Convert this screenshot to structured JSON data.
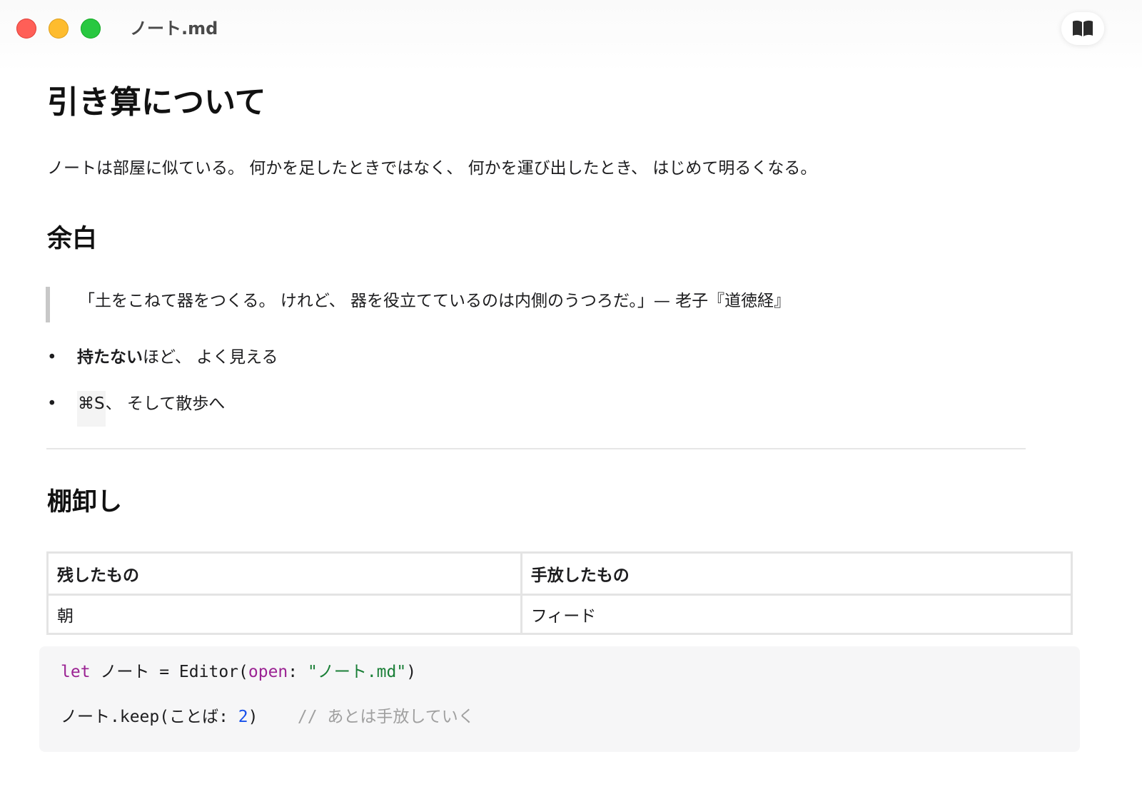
{
  "window": {
    "title": "ノート.md",
    "reader_icon": "book-open-icon"
  },
  "document": {
    "title": "引き算について",
    "intro": "ノートは部屋に似ている。 何かを足したときではなく、 何かを運び出したとき、 はじめて明るくなる。",
    "section_margin": {
      "heading": "余白",
      "quote": "「土をこねて器をつくる。 けれど、 器を役立てているのは内側のうつろだ。」— 老子『道徳経』",
      "bullets": [
        {
          "bold": "持たない",
          "rest": "ほど、 よく見える"
        },
        {
          "kbd": "⌘S",
          "rest": "、 そして散歩へ"
        }
      ],
      "bullet_symbol": "•"
    },
    "section_inventory": {
      "heading": "棚卸し",
      "table": {
        "headers": [
          "残したもの",
          "手放したもの"
        ],
        "rows": [
          [
            "朝",
            "フィード"
          ]
        ]
      }
    },
    "code": {
      "line1": {
        "keyword": "let",
        "var": " ノート = Editor(",
        "param": "open",
        "colon": ": ",
        "string": "\"ノート.md\"",
        "close": ")"
      },
      "line2": {
        "call": "ノート.keep(ことば: ",
        "number": "2",
        "close": ")",
        "comment": "    // あとは手放していく"
      }
    }
  }
}
